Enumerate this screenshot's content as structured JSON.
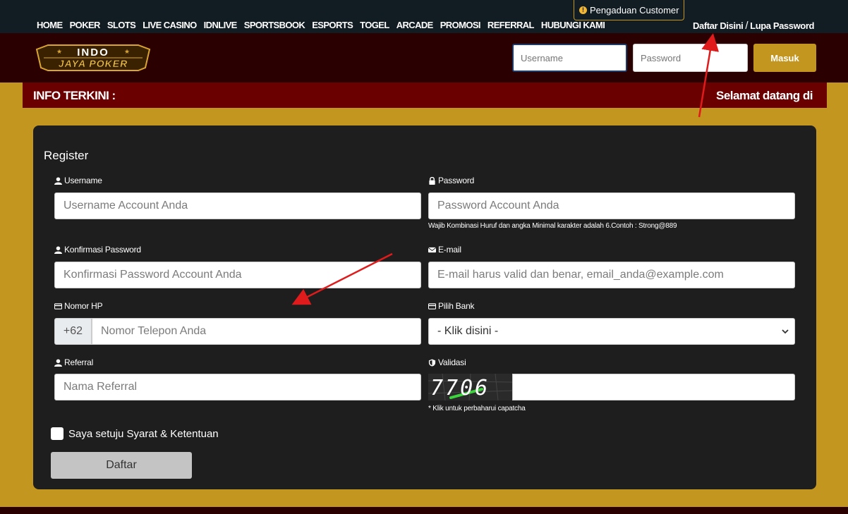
{
  "nav": {
    "items": [
      "HOME",
      "POKER",
      "SLOTS",
      "LIVE CASINO",
      "IDNLIVE",
      "SPORTSBOOK",
      "ESPORTS",
      "TOGEL",
      "ARCADE",
      "PROMOSI",
      "REFERRAL",
      "HUBUNGI KAMI"
    ]
  },
  "complaint": {
    "label": "Pengaduan Customer",
    "icon": "warning-icon"
  },
  "auth": {
    "register": "Daftar Disini",
    "separator": "/",
    "forgot": "Lupa Password"
  },
  "logo": {
    "line1": "INDO",
    "line2": "JAYA POKER"
  },
  "login": {
    "username_placeholder": "Username",
    "password_placeholder": "Password",
    "submit": "Masuk"
  },
  "info": {
    "label": "INFO TERKINI :",
    "ticker": "Selamat datang di"
  },
  "register": {
    "title": "Register",
    "username": {
      "label": "Username",
      "placeholder": "Username Account Anda"
    },
    "password": {
      "label": "Password",
      "placeholder": "Password Account Anda",
      "hint": "Wajib Kombinasi Huruf dan angka Minimal karakter adalah 6.Contoh : Strong@889"
    },
    "confirm": {
      "label": "Konfirmasi Password",
      "placeholder": "Konfirmasi Password Account Anda"
    },
    "email": {
      "label": "E-mail",
      "placeholder": "E-mail harus valid dan benar, email_anda@example.com"
    },
    "phone": {
      "label": "Nomor HP",
      "prefix": "+62",
      "placeholder": "Nomor Telepon Anda"
    },
    "bank": {
      "label": "Pilih Bank",
      "selected": "- Klik disini -"
    },
    "referral": {
      "label": "Referral",
      "placeholder": "Nama Referral"
    },
    "validation": {
      "label": "Validasi",
      "captcha": "7706",
      "hint": "* Klik untuk perbaharui capatcha"
    },
    "agree": "Saya setuju Syarat & Ketentuan",
    "submit": "Daftar"
  },
  "colors": {
    "gold": "#c3961f",
    "maroon": "#2b0000",
    "navy": "#121c23",
    "panel": "#1e1e1e"
  }
}
